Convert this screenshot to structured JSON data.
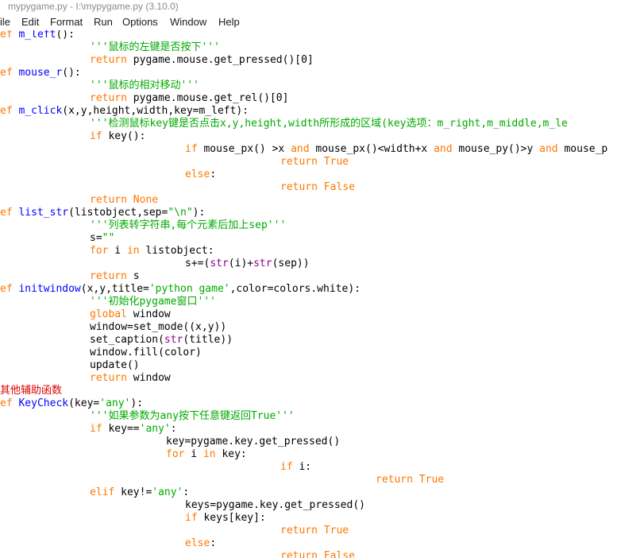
{
  "window": {
    "title": "mypygame.py - I:\\mypygame.py (3.10.0)"
  },
  "menu": {
    "items": [
      "ile",
      "Edit",
      "Format",
      "Run",
      "Options",
      "Window",
      "Help"
    ]
  },
  "editor": {
    "colors": {
      "keyword": "#ff7700",
      "definition": "#0000ff",
      "string": "#00aa00",
      "builtin": "#900090",
      "comment": "#dd0000",
      "text": "#000000"
    },
    "lines": [
      [
        [
          "kw",
          "ef "
        ],
        [
          "def",
          "m_left"
        ],
        [
          "txt",
          "():"
        ]
      ],
      [
        [
          "str",
          "'''鼠标的左键是否按下'''"
        ]
      ],
      [
        [
          "kw",
          "return"
        ],
        [
          "txt",
          " pygame.mouse.get_pressed()[0]"
        ]
      ],
      [
        [
          "kw",
          "ef "
        ],
        [
          "def",
          "mouse_r"
        ],
        [
          "txt",
          "():"
        ]
      ],
      [
        [
          "str",
          "'''鼠标的相对移动'''"
        ]
      ],
      [
        [
          "kw",
          "return"
        ],
        [
          "txt",
          " pygame.mouse.get_rel()[0]"
        ]
      ],
      [
        [
          "kw",
          "ef "
        ],
        [
          "def",
          "m_click"
        ],
        [
          "txt",
          "(x,y,height,width,key=m_left):"
        ]
      ],
      [
        [
          "str",
          "'''检测鼠标key键是否点击x,y,height,width所形成的区域(key选项：m_right,m_middle,m_le"
        ]
      ],
      [
        [
          "kw",
          "if"
        ],
        [
          "txt",
          " key():"
        ]
      ],
      [
        [
          "kw",
          "if"
        ],
        [
          "txt",
          " mouse_px() >x "
        ],
        [
          "kw",
          "and"
        ],
        [
          "txt",
          " mouse_px()<width+x "
        ],
        [
          "kw",
          "and"
        ],
        [
          "txt",
          " mouse_py()>y "
        ],
        [
          "kw",
          "and"
        ],
        [
          "txt",
          " mouse_p"
        ]
      ],
      [
        [
          "kw",
          "return True"
        ]
      ],
      [
        [
          "kw",
          "else"
        ],
        [
          "txt",
          ":"
        ]
      ],
      [
        [
          "kw",
          "return False"
        ]
      ],
      [
        [
          "kw",
          "return None"
        ]
      ],
      [
        [
          "kw",
          "ef "
        ],
        [
          "def",
          "list_str"
        ],
        [
          "txt",
          "(listobject,sep="
        ],
        [
          "str",
          "\"\\n\""
        ],
        [
          "txt",
          "):"
        ]
      ],
      [
        [
          "str",
          "'''列表转字符串,每个元素后加上sep'''"
        ]
      ],
      [
        [
          "txt",
          "s="
        ],
        [
          "str",
          "\"\""
        ]
      ],
      [
        [
          "kw",
          "for"
        ],
        [
          "txt",
          " i "
        ],
        [
          "kw",
          "in"
        ],
        [
          "txt",
          " listobject:"
        ]
      ],
      [
        [
          "txt",
          "s+=("
        ],
        [
          "bi",
          "str"
        ],
        [
          "txt",
          "(i)+"
        ],
        [
          "bi",
          "str"
        ],
        [
          "txt",
          "(sep))"
        ]
      ],
      [
        [
          "kw",
          "return"
        ],
        [
          "txt",
          " s"
        ]
      ],
      [
        [
          "kw",
          "ef "
        ],
        [
          "def",
          "initwindow"
        ],
        [
          "txt",
          "(x,y,title="
        ],
        [
          "str",
          "'python game'"
        ],
        [
          "txt",
          ",color=colors.white):"
        ]
      ],
      [
        [
          "str",
          "'''初始化pygame窗口'''"
        ]
      ],
      [
        [
          "kw",
          "global"
        ],
        [
          "txt",
          " window"
        ]
      ],
      [
        [
          "txt",
          "window=set_mode((x,y))"
        ]
      ],
      [
        [
          "txt",
          "set_caption("
        ],
        [
          "bi",
          "str"
        ],
        [
          "txt",
          "(title))"
        ]
      ],
      [
        [
          "txt",
          "window.fill(color)"
        ]
      ],
      [
        [
          "txt",
          "update()"
        ]
      ],
      [
        [
          "kw",
          "return"
        ],
        [
          "txt",
          " window"
        ]
      ],
      [
        [
          "cm",
          "其他辅助函数"
        ]
      ],
      [
        [
          "kw",
          "ef "
        ],
        [
          "def",
          "KeyCheck"
        ],
        [
          "txt",
          "(key="
        ],
        [
          "str",
          "'any'"
        ],
        [
          "txt",
          "):"
        ]
      ],
      [
        [
          "str",
          "'''如果参数为any按下任意键返回True'''"
        ]
      ],
      [
        [
          "kw",
          "if"
        ],
        [
          "txt",
          " key=="
        ],
        [
          "str",
          "'any'"
        ],
        [
          "txt",
          ":"
        ]
      ],
      [
        [
          "txt",
          "key=pygame.key.get_pressed()"
        ]
      ],
      [
        [
          "kw",
          "for"
        ],
        [
          "txt",
          " i "
        ],
        [
          "kw",
          "in"
        ],
        [
          "txt",
          " key:"
        ]
      ],
      [
        [
          "kw",
          "if"
        ],
        [
          "txt",
          " i:"
        ]
      ],
      [
        [
          "kw",
          "return True"
        ]
      ],
      [
        [
          "kw",
          "elif"
        ],
        [
          "txt",
          " key!="
        ],
        [
          "str",
          "'any'"
        ],
        [
          "txt",
          ":"
        ]
      ],
      [
        [
          "txt",
          "keys=pygame.key.get_pressed()"
        ]
      ],
      [
        [
          "kw",
          "if"
        ],
        [
          "txt",
          " keys[key]:"
        ]
      ],
      [
        [
          "kw",
          "return True"
        ]
      ],
      [
        [
          "kw",
          "else"
        ],
        [
          "txt",
          ":"
        ]
      ],
      [
        [
          "kw",
          "return False"
        ]
      ]
    ]
  }
}
